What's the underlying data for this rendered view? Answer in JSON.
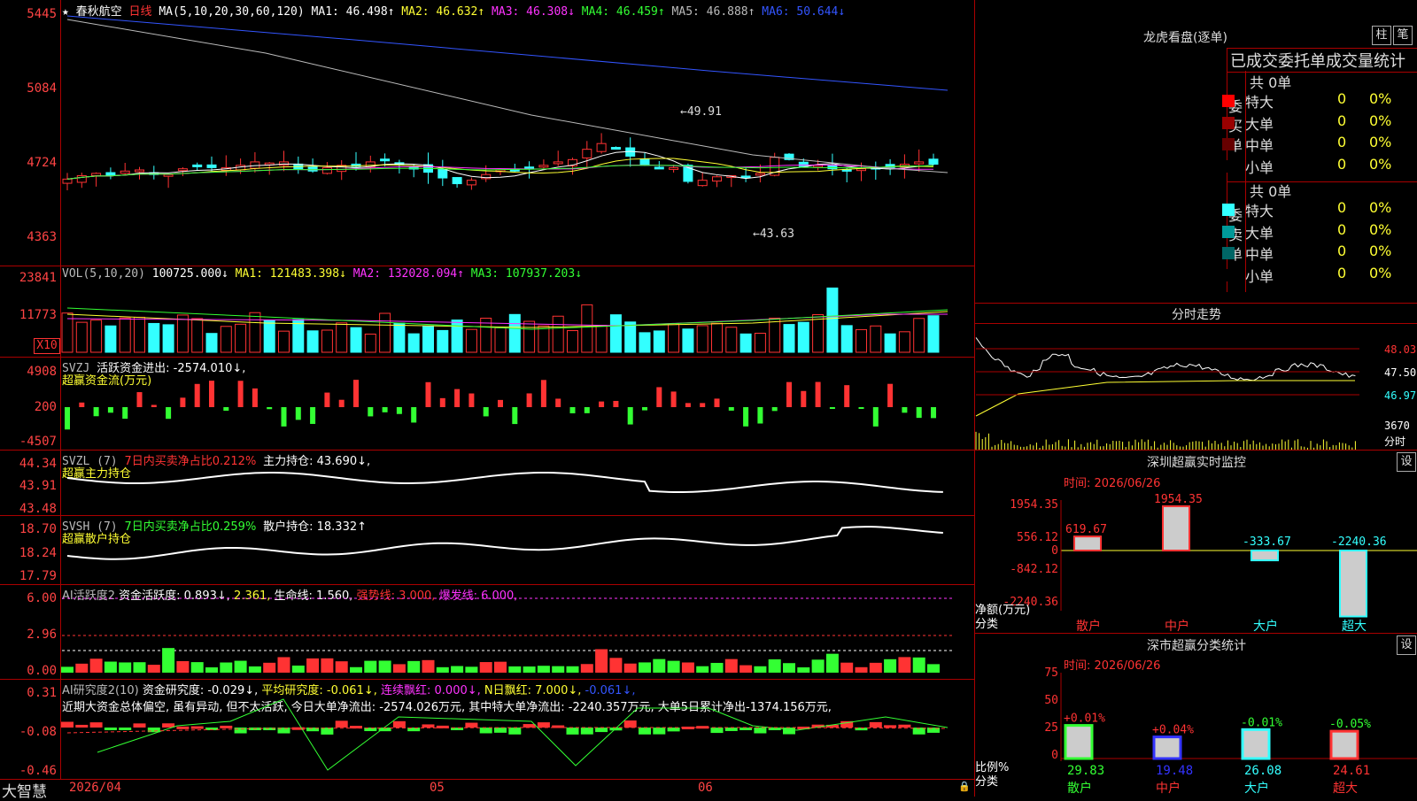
{
  "main_chart": {
    "star": "★",
    "stock_name": "春秋航空",
    "period": "日线",
    "ma_header": "MA(5,10,20,30,60,120)",
    "ma_values": [
      {
        "label": "MA1:",
        "value": "46.498↑",
        "color": "#ffffff"
      },
      {
        "label": "MA2:",
        "value": "46.632↑",
        "color": "#ffff33"
      },
      {
        "label": "MA3:",
        "value": "46.308↓",
        "color": "#ff33ff"
      },
      {
        "label": "MA4:",
        "value": "46.459↑",
        "color": "#33ff33"
      },
      {
        "label": "MA5:",
        "value": "46.888↑",
        "color": "#bbbbbb"
      },
      {
        "label": "MA6:",
        "value": "50.644↓",
        "color": "#3355ff"
      }
    ],
    "y_ticks": [
      "5445",
      "5084",
      "4724",
      "4363"
    ],
    "high_marker": "49.91",
    "low_marker": "43.63"
  },
  "volume": {
    "title": "VOL(5,10,20)",
    "value": "100725.000↓",
    "ma1": "MA1: 121483.398↓",
    "ma2": "MA2: 132028.094↑",
    "ma3": "MA3: 107937.203↓",
    "y_ticks": [
      "23841",
      "11773"
    ],
    "unit": "X10"
  },
  "svzj": {
    "title": "SVZJ",
    "line1": "活跃资金进出: -2574.010↓,",
    "line2": "超赢资金流(万元)",
    "y_ticks": [
      "4908",
      "200",
      "-4507"
    ]
  },
  "svzl": {
    "title": "SVZL (7)",
    "ratio": "7日内买卖净占比0.212%",
    "holding": "主力持仓: 43.690↓,",
    "line2": "超赢主力持仓",
    "y_ticks": [
      "44.34",
      "43.91",
      "43.48"
    ]
  },
  "svsh": {
    "title": "SVSH (7)",
    "ratio": "7日内买卖净占比0.259%",
    "holding": "散户持仓: 18.332↑",
    "line2": "超赢散户持仓",
    "y_ticks": [
      "18.70",
      "18.24",
      "17.79"
    ]
  },
  "ai_active": {
    "title": "AI活跃度2",
    "p1": "资金活跃度: 0.893↓,",
    "p2": "2.361,",
    "p3": "生命线: 1.560,",
    "p4": "强势线: 3.000,",
    "p5": "爆发线: 6.000,",
    "y_ticks": [
      "6.00",
      "2.96",
      "0.00"
    ]
  },
  "ai_research": {
    "title": "AI研究度2(10)",
    "p1": "资金研究度: -0.029↓,",
    "p2": "平均研究度: -0.061↓,",
    "p3": "连续飘红: 0.000↓,",
    "p4": "N日飘红: 7.000↓,",
    "p5": "-0.061↓,",
    "comment": "近期大资金总体偏空, 虽有异动, 但不太活跃, 今日大单净流出: -2574.026万元, 其中特大单净流出: -2240.357万元, 大单5日累计净出-1374.156万元,",
    "y_ticks": [
      "0.31",
      "-0.08",
      "-0.46"
    ]
  },
  "bottom_bar": {
    "brand": "大智慧",
    "date_start": "2026/04",
    "m5": "05",
    "m6": "06"
  },
  "right_panel": {
    "dragon_title": "龙虎看盘(逐单)",
    "btn_zhu": "柱",
    "btn_bi": "笔",
    "subtitle": "已成交委托单成交量统计",
    "buy": {
      "label": "委买单",
      "total": "共 0单",
      "rows": [
        {
          "name": "特大",
          "count": "0",
          "pct": "0%",
          "color": "#ff0000"
        },
        {
          "name": "大单",
          "count": "0",
          "pct": "0%",
          "color": "#990000"
        },
        {
          "name": "中单",
          "count": "0",
          "pct": "0%",
          "color": "#660000"
        },
        {
          "name": "小单",
          "count": "0",
          "pct": "0%",
          "color": "#000000"
        }
      ]
    },
    "sell": {
      "label": "委卖单",
      "total": "共 0单",
      "rows": [
        {
          "name": "特大",
          "count": "0",
          "pct": "0%",
          "color": "#33ffff"
        },
        {
          "name": "大单",
          "count": "0",
          "pct": "0%",
          "color": "#009999"
        },
        {
          "name": "中单",
          "count": "0",
          "pct": "0%",
          "color": "#006666"
        },
        {
          "name": "小单",
          "count": "0",
          "pct": "0%",
          "color": "#000000"
        }
      ]
    },
    "intraday_title": "分时走势",
    "intraday_ticks": [
      "48.03",
      "47.50",
      "46.97",
      "3670",
      "分时"
    ],
    "sz_monitor_title": "深圳超赢实时监控",
    "sz_monitor_btn": "设",
    "sz_time": "时间: 2026/06/26",
    "sz_y_ticks": [
      "1954.35",
      "556.12",
      "0",
      "-842.12",
      "-2240.36"
    ],
    "sz_y_caption": "净额(万元)",
    "sz_x_caption": "分类",
    "sz_bars": [
      {
        "name": "散户",
        "value": 619.67,
        "label": "619.67"
      },
      {
        "name": "中户",
        "value": 1954.35,
        "label": "1954.35"
      },
      {
        "name": "大户",
        "value": -333.67,
        "label": "-333.67"
      },
      {
        "name": "超大",
        "value": -2240.36,
        "label": "-2240.36"
      }
    ],
    "sz_class_title": "深市超赢分类统计",
    "sz_class_btn": "设",
    "sz_class_time": "时间: 2026/06/26",
    "sz_class_y_ticks": [
      "75",
      "50",
      "25",
      "0"
    ],
    "sz_class_y_caption": "比例%",
    "sz_class_x_caption": "分类",
    "sz_class_bars": [
      {
        "name": "散户",
        "value": 29.83,
        "label": "29.83",
        "delta": "+0.01%",
        "color": "#33ff33"
      },
      {
        "name": "中户",
        "value": 19.48,
        "label": "19.48",
        "delta": "+0.04%",
        "color": "#3333ff"
      },
      {
        "name": "大户",
        "value": 26.08,
        "label": "26.08",
        "delta": "-0.01%",
        "color": "#33ffff"
      },
      {
        "name": "超大",
        "value": 24.61,
        "label": "24.61",
        "delta": "-0.05%",
        "color": "#ff3333"
      }
    ]
  }
}
